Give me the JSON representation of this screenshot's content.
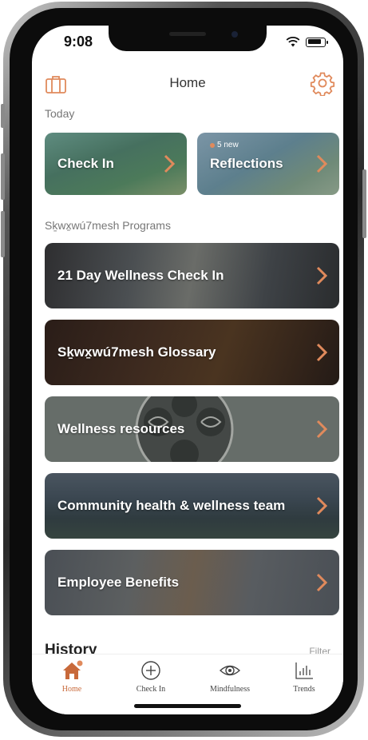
{
  "status": {
    "time": "9:08"
  },
  "nav": {
    "title": "Home"
  },
  "sections": {
    "today": "Today",
    "programs": "Sḵwx̱wú7mesh Programs"
  },
  "today_cards": [
    {
      "title": "Check In"
    },
    {
      "title": "Reflections",
      "badge": "5 new"
    }
  ],
  "program_cards": [
    {
      "title": "21 Day Wellness Check In"
    },
    {
      "title": "Sḵwx̱wú7mesh Glossary"
    },
    {
      "title": "Wellness resources"
    },
    {
      "title": "Community health & wellness team"
    },
    {
      "title": "Employee Benefits"
    }
  ],
  "history": {
    "title": "History",
    "filter": "Filter"
  },
  "tabs": [
    {
      "label": "Home",
      "icon": "home-icon",
      "active": true
    },
    {
      "label": "Check In",
      "icon": "plus-circle-icon"
    },
    {
      "label": "Mindfulness",
      "icon": "eye-icon"
    },
    {
      "label": "Trends",
      "icon": "bar-chart-icon"
    }
  ],
  "colors": {
    "accent": "#e08a5c",
    "active_tab": "#c8693a"
  }
}
